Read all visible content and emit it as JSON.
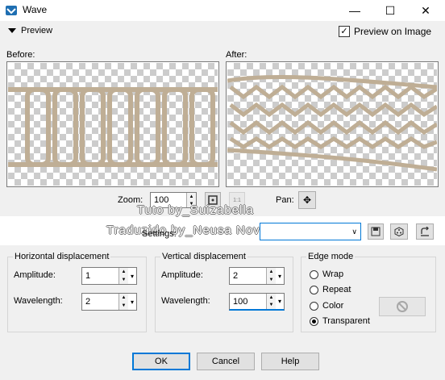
{
  "window": {
    "title": "Wave",
    "minimize": "—",
    "maximize": "☐",
    "close": "✕"
  },
  "preview": {
    "toggle_label": "Preview",
    "on_image_label": "Preview on Image",
    "on_image_checked": true,
    "before_label": "Before:",
    "after_label": "After:"
  },
  "zoom": {
    "label": "Zoom:",
    "value": "100",
    "actual_size": "1:1"
  },
  "pan": {
    "label": "Pan:"
  },
  "watermark": {
    "line1": "Tuto by_Suizabella",
    "line2": "Traduzido by_Neusa Novaes"
  },
  "settings": {
    "label": "Settings:",
    "value": ""
  },
  "horizontal": {
    "title": "Horizontal displacement",
    "amplitude_label": "Amplitude:",
    "amplitude": "1",
    "wavelength_label": "Wavelength:",
    "wavelength": "2"
  },
  "vertical": {
    "title": "Vertical displacement",
    "amplitude_label": "Amplitude:",
    "amplitude": "2",
    "wavelength_label": "Wavelength:",
    "wavelength": "100"
  },
  "edge": {
    "title": "Edge mode",
    "options": [
      "Wrap",
      "Repeat",
      "Color",
      "Transparent"
    ],
    "selected": "Transparent"
  },
  "buttons": {
    "ok": "OK",
    "cancel": "Cancel",
    "help": "Help"
  },
  "colors": {
    "stroke": "#bfae95",
    "accent": "#0078d7"
  }
}
